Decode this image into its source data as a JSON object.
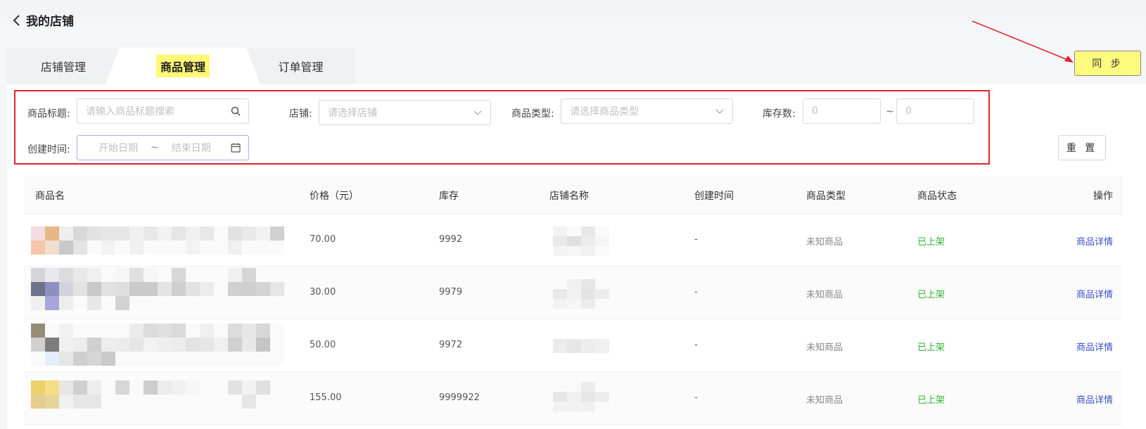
{
  "header": {
    "title": "我的店铺"
  },
  "tabs": [
    {
      "label": "店铺管理"
    },
    {
      "label": "商品管理",
      "active": true
    },
    {
      "label": "订单管理"
    }
  ],
  "sync_button": "同 步",
  "filters": {
    "title_label": "商品标题:",
    "title_placeholder": "请输入商品标题搜索",
    "store_label": "店铺:",
    "store_placeholder": "请选择店铺",
    "type_label": "商品类型:",
    "type_placeholder": "请选择商品类型",
    "stock_label": "库存数:",
    "stock_min": "0",
    "stock_max": "0",
    "range_sep": "~",
    "created_label": "创建时间:",
    "start_date": "开始日期",
    "end_date": "结束日期",
    "reset_button": "重 置"
  },
  "table": {
    "columns": [
      "商品名",
      "价格（元）",
      "库存",
      "店铺名称",
      "创建时间",
      "商品类型",
      "商品状态",
      "操作"
    ],
    "rows": [
      {
        "price": "70.00",
        "stock": "9992",
        "created": "-",
        "type": "未知商品",
        "status": "已上架",
        "action": "商品详情"
      },
      {
        "price": "30.00",
        "stock": "9979",
        "created": "-",
        "type": "未知商品",
        "status": "已上架",
        "action": "商品详情"
      },
      {
        "price": "50.00",
        "stock": "9972",
        "created": "-",
        "type": "未知商品",
        "status": "已上架",
        "action": "商品详情"
      },
      {
        "price": "155.00",
        "stock": "9999922",
        "created": "-",
        "type": "未知商品",
        "status": "已上架",
        "action": "商品详情"
      }
    ]
  },
  "colors": {
    "highlight": "#fff876",
    "annotation_red": "#e3232d",
    "status_green": "#2bb52e",
    "link_blue": "#3c4fc8"
  },
  "icons": [
    "back-arrow-icon",
    "search-icon",
    "chevron-down-icon",
    "calendar-icon"
  ]
}
